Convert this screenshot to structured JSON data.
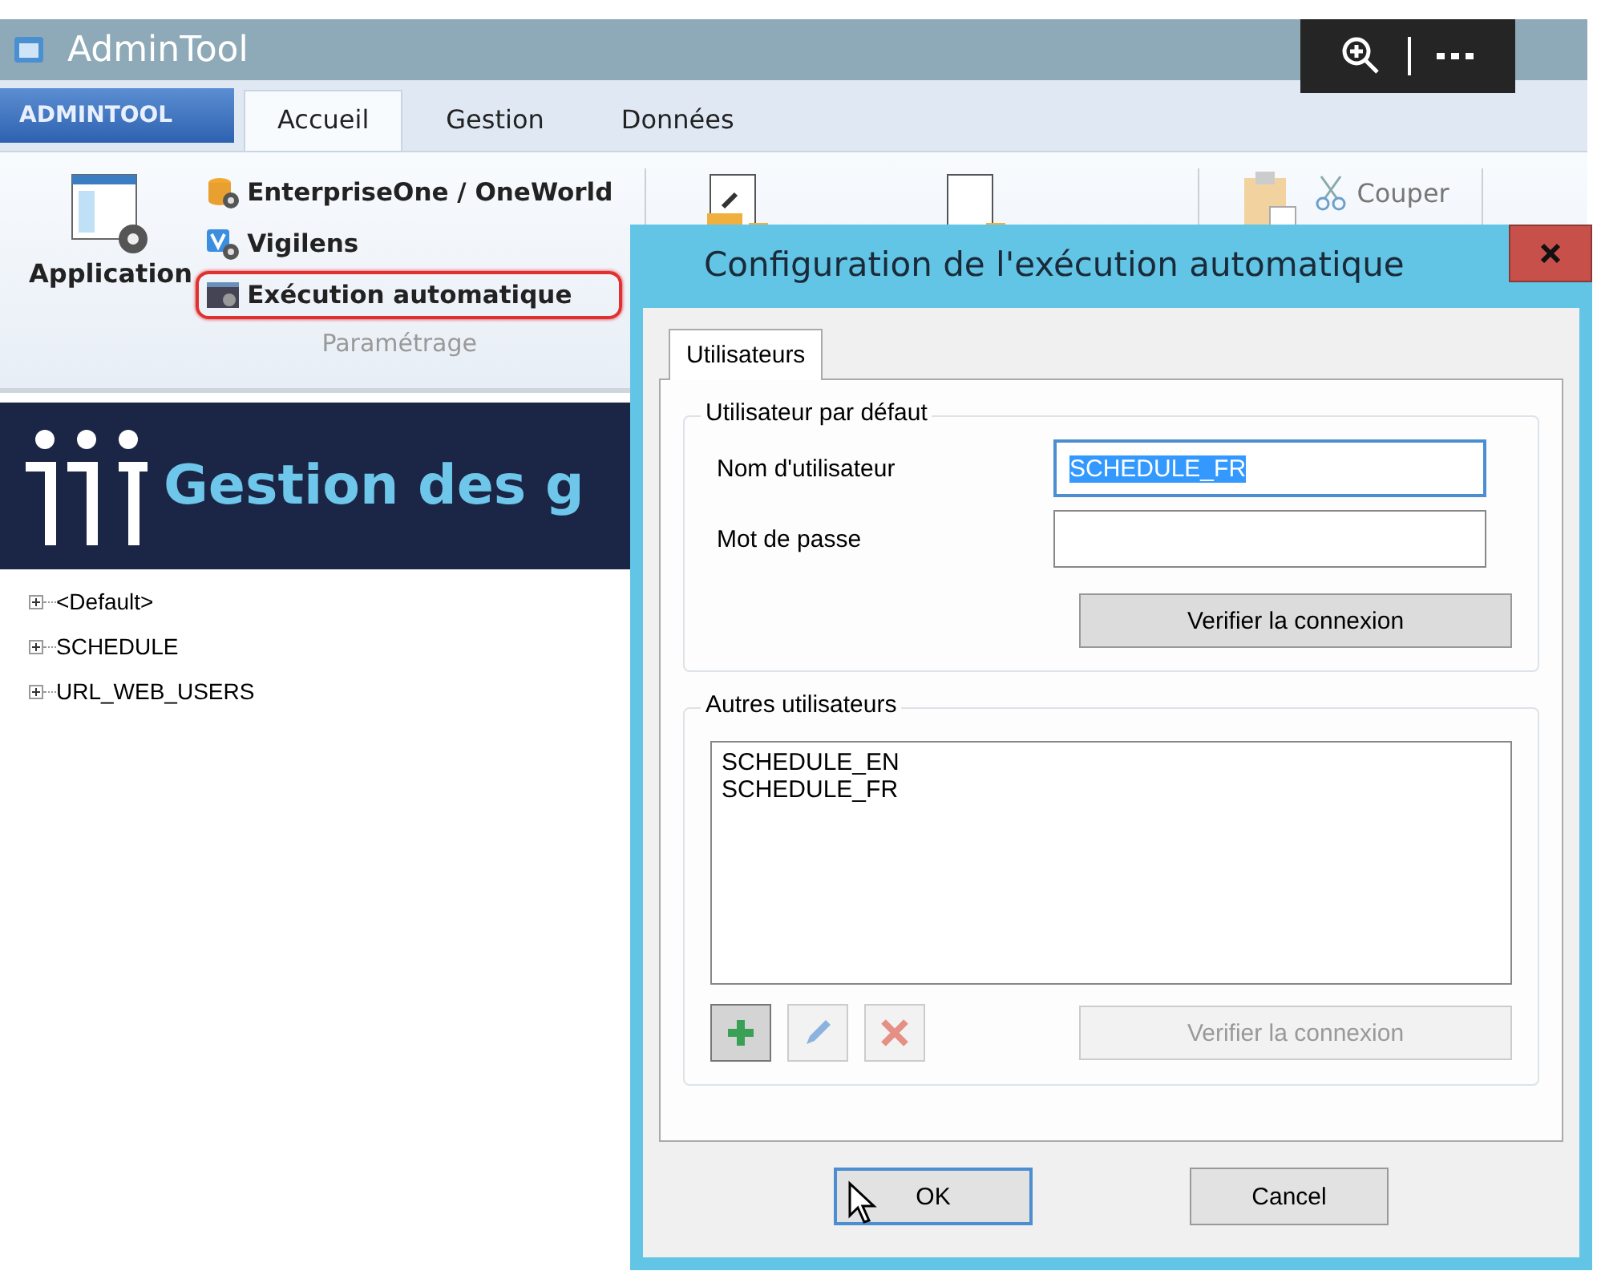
{
  "window": {
    "title": "AdminTool"
  },
  "ribbon": {
    "app_menu": "ADMINTOOL",
    "tabs": [
      {
        "label": "Accueil",
        "selected": true
      },
      {
        "label": "Gestion",
        "selected": false
      },
      {
        "label": "Données",
        "selected": false
      }
    ],
    "application_button": "Application",
    "items": [
      {
        "label": "EnterpriseOne / OneWorld",
        "kind": "database",
        "highlighted": false
      },
      {
        "label": "Vigilens",
        "kind": "vigilens",
        "highlighted": false
      },
      {
        "label": "Exécution automatique",
        "kind": "console",
        "highlighted": true
      }
    ],
    "group_label": "Paramétrage",
    "cut_button": "Couper"
  },
  "banner": {
    "title": "Gestion des g"
  },
  "tree": [
    {
      "label": "<Default>",
      "expanded": false
    },
    {
      "label": "SCHEDULE",
      "expanded": false
    },
    {
      "label": "URL_WEB_USERS",
      "expanded": false
    }
  ],
  "dialog": {
    "title": "Configuration de l'exécution automatique",
    "tabs": [
      {
        "label": "Utilisateurs",
        "selected": true
      }
    ],
    "default_user": {
      "legend": "Utilisateur par défaut",
      "username_label": "Nom d'utilisateur",
      "username_value": "SCHEDULE_FR",
      "username_value_selected": true,
      "password_label": "Mot de passe",
      "verify_button": {
        "label": "Verifier la connexion",
        "disabled": false
      }
    },
    "other_users": {
      "legend": "Autres utilisateurs",
      "list": [
        "SCHEDULE_EN",
        "SCHEDULE_FR"
      ],
      "tools": [
        {
          "kind": "add",
          "disabled": false,
          "pressed": true
        },
        {
          "kind": "edit",
          "disabled": true,
          "pressed": false
        },
        {
          "kind": "delete",
          "disabled": true,
          "pressed": false
        }
      ],
      "verify_button": {
        "label": "Verifier la connexion",
        "disabled": true
      }
    },
    "ok_button": {
      "label": "OK",
      "focused": true
    },
    "cancel_button": {
      "label": "Cancel",
      "focused": false
    }
  }
}
